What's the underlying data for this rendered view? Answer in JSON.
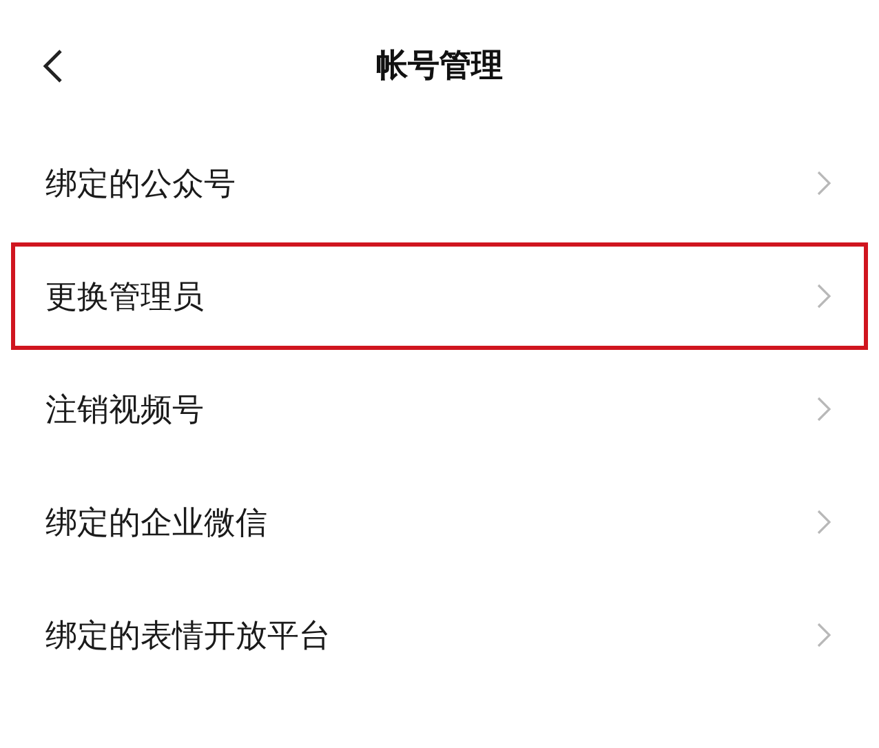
{
  "header": {
    "title": "帐号管理"
  },
  "items": [
    {
      "label": "绑定的公众号",
      "highlighted": false
    },
    {
      "label": "更换管理员",
      "highlighted": true
    },
    {
      "label": "注销视频号",
      "highlighted": false
    },
    {
      "label": "绑定的企业微信",
      "highlighted": false
    },
    {
      "label": "绑定的表情开放平台",
      "highlighted": false
    }
  ]
}
